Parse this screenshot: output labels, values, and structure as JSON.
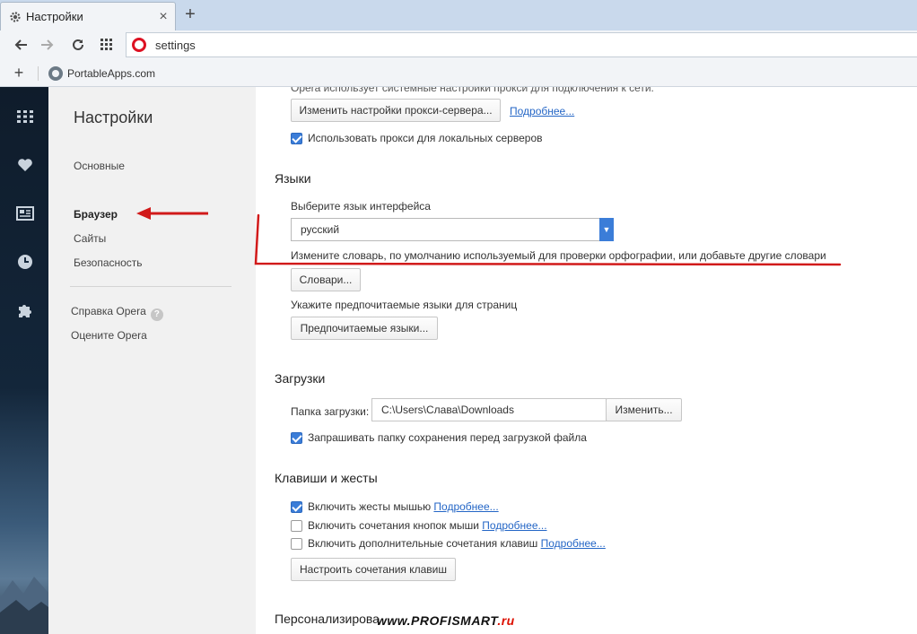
{
  "browser": {
    "tab_title": "Настройки",
    "tab_close": "×",
    "new_tab": "+",
    "address": "settings",
    "bookmark_add": "+",
    "bookmark": "PortableApps.com"
  },
  "settings_nav": {
    "title": "Настройки",
    "items": [
      "Основные",
      "Браузер",
      "Сайты",
      "Безопасность"
    ],
    "active": "Браузер",
    "help": "Справка Opera",
    "rate": "Оцените Opera"
  },
  "proxy": {
    "intro": "Opera использует системные настройки прокси для подключения к сети.",
    "change_button": "Изменить настройки прокси-сервера...",
    "more_link": "Подробнее...",
    "local_proxy_label": "Использовать прокси для локальных серверов",
    "local_proxy_checked": true
  },
  "languages": {
    "title": "Языки",
    "choose_label": "Выберите язык интерфейса",
    "selected_language": "русский",
    "dictionary_label": "Измените словарь, по умолчанию используемый для проверки орфографии, или добавьте другие словари",
    "dictionaries_button": "Словари...",
    "preferred_label": "Укажите предпочитаемые языки для страниц",
    "preferred_button": "Предпочитаемые языки..."
  },
  "downloads": {
    "title": "Загрузки",
    "folder_label": "Папка загрузки:",
    "folder_value": "C:\\Users\\Слава\\Downloads",
    "change_button": "Изменить...",
    "ask_label": "Запрашивать папку сохранения перед загрузкой файла",
    "ask_checked": true
  },
  "keys": {
    "title": "Клавиши и жесты",
    "options": [
      {
        "label": "Включить жесты мышью",
        "link": "Подробнее...",
        "checked": true
      },
      {
        "label": "Включить сочетания кнопок мыши",
        "link": "Подробнее...",
        "checked": false
      },
      {
        "label": "Включить дополнительные сочетания клавиш",
        "link": "Подробнее...",
        "checked": false
      }
    ],
    "configure_button": "Настроить сочетания клавиш"
  },
  "personalize": {
    "title": "Персонализирова"
  },
  "watermark": {
    "prefix": "www.",
    "brand": "PROFISMART",
    "suffix": ".ru"
  },
  "colors": {
    "accent": "#3b7dd8",
    "link": "#2466c6",
    "annotation": "#d11a1a",
    "opera_red": "#dd1122"
  }
}
